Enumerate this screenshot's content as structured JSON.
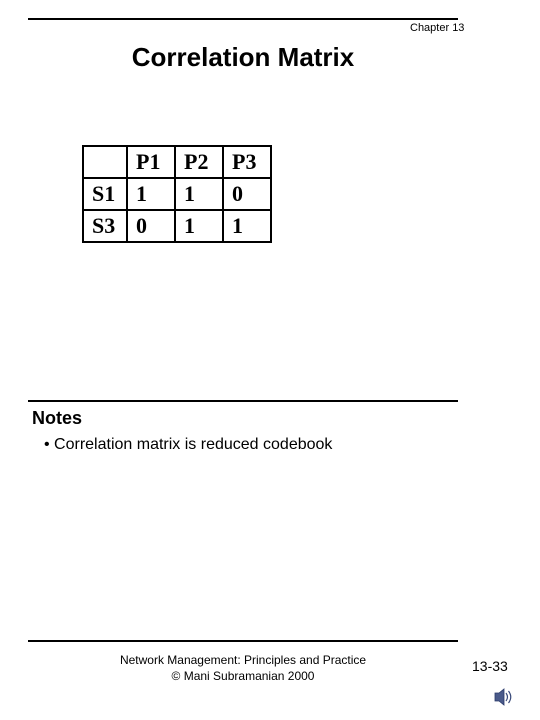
{
  "chapter": "Chapter 13",
  "title": "Correlation Matrix",
  "table": {
    "headers": [
      "",
      "P1",
      "P2",
      "P3"
    ],
    "rows": [
      {
        "label": "S1",
        "values": [
          "1",
          "1",
          "0"
        ]
      },
      {
        "label": "S3",
        "values": [
          "0",
          "1",
          "1"
        ]
      }
    ]
  },
  "notes_heading": "Notes",
  "notes_bullet": "• Correlation matrix is reduced codebook",
  "footer_line1": "Network Management: Principles and Practice",
  "footer_line2": "©  Mani Subramanian 2000",
  "page_number": "13-33",
  "chart_data": {
    "type": "table",
    "title": "Correlation Matrix",
    "columns": [
      "",
      "P1",
      "P2",
      "P3"
    ],
    "rows": [
      [
        "S1",
        1,
        1,
        0
      ],
      [
        "S3",
        0,
        1,
        1
      ]
    ]
  }
}
